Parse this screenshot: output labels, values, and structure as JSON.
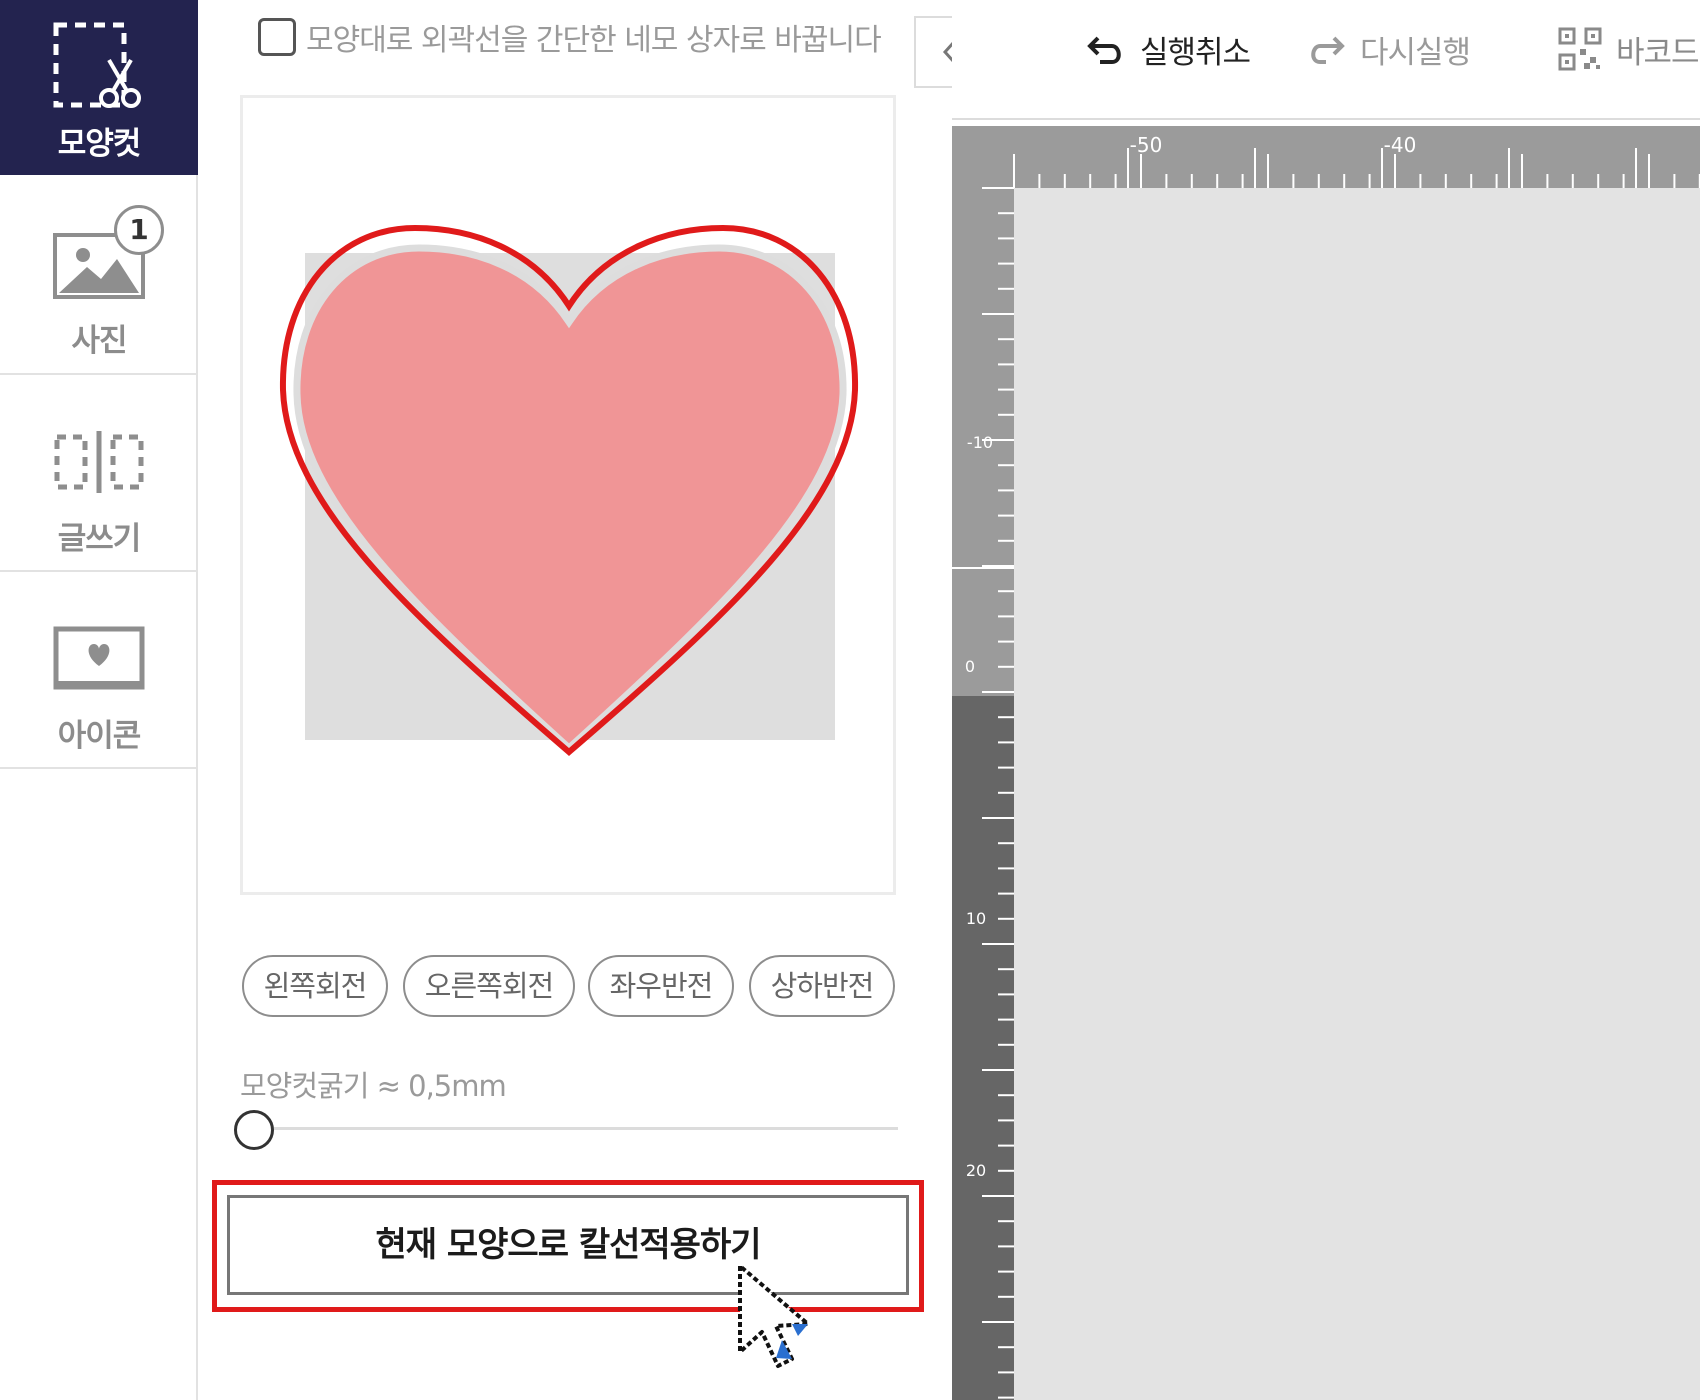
{
  "sidebar": {
    "items": [
      {
        "label": "모양컷",
        "icon": "shape-cut-icon",
        "active": true
      },
      {
        "label": "사진",
        "icon": "photo-icon",
        "badge": "1"
      },
      {
        "label": "글쓰기",
        "icon": "text-box-icon"
      },
      {
        "label": "아이콘",
        "icon": "heart-frame-icon"
      }
    ]
  },
  "panel": {
    "checkbox_label": "모양대로 외곽선을 간단한 네모 상자로 바꿉니다",
    "checkbox_checked": false,
    "rotate_buttons": [
      "왼쪽회전",
      "오른쪽회전",
      "좌우반전",
      "상하반전"
    ],
    "thickness_label": "모양컷굵기 ≈ 0,5mm",
    "thickness_level": 0,
    "apply_button": "현재 모양으로 칼선적용하기"
  },
  "toolbar": {
    "undo": "실행취소",
    "redo": "다시실행",
    "barcode": "바코드"
  },
  "ruler": {
    "top_labels": [
      "-50",
      "-40"
    ],
    "left_labels": [
      "-10",
      "0",
      "10",
      "20"
    ]
  },
  "colors": {
    "sidebar_active_bg": "#23234f",
    "highlight_red": "#e01a1a",
    "heart_fill": "#f09596",
    "ruler_gray": "#9b9b9b",
    "ruler_dark": "#666666",
    "canvas_bg": "#e3e3e3"
  },
  "cursor": "arrow-pointer-icon"
}
